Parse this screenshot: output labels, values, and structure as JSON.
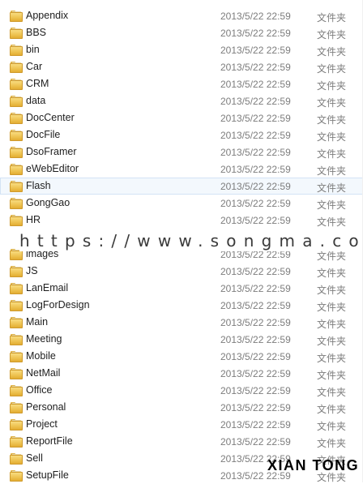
{
  "files": [
    {
      "name": "Appendix",
      "date": "2013/5/22 22:59",
      "type": "文件夹"
    },
    {
      "name": "BBS",
      "date": "2013/5/22 22:59",
      "type": "文件夹"
    },
    {
      "name": "bin",
      "date": "2013/5/22 22:59",
      "type": "文件夹"
    },
    {
      "name": "Car",
      "date": "2013/5/22 22:59",
      "type": "文件夹"
    },
    {
      "name": "CRM",
      "date": "2013/5/22 22:59",
      "type": "文件夹"
    },
    {
      "name": "data",
      "date": "2013/5/22 22:59",
      "type": "文件夹"
    },
    {
      "name": "DocCenter",
      "date": "2013/5/22 22:59",
      "type": "文件夹"
    },
    {
      "name": "DocFile",
      "date": "2013/5/22 22:59",
      "type": "文件夹"
    },
    {
      "name": "DsoFramer",
      "date": "2013/5/22 22:59",
      "type": "文件夹"
    },
    {
      "name": "eWebEditor",
      "date": "2013/5/22 22:59",
      "type": "文件夹"
    },
    {
      "name": "Flash",
      "date": "2013/5/22 22:59",
      "type": "文件夹",
      "selected": true
    },
    {
      "name": "GongGao",
      "date": "2013/5/22 22:59",
      "type": "文件夹"
    },
    {
      "name": "HR",
      "date": "2013/5/22 22:59",
      "type": "文件夹"
    },
    {
      "name": "",
      "date": "",
      "type": "",
      "hidden": true
    },
    {
      "name": "images",
      "date": "2013/5/22 22:59",
      "type": "文件夹"
    },
    {
      "name": "JS",
      "date": "2013/5/22 22:59",
      "type": "文件夹"
    },
    {
      "name": "LanEmail",
      "date": "2013/5/22 22:59",
      "type": "文件夹"
    },
    {
      "name": "LogForDesign",
      "date": "2013/5/22 22:59",
      "type": "文件夹"
    },
    {
      "name": "Main",
      "date": "2013/5/22 22:59",
      "type": "文件夹"
    },
    {
      "name": "Meeting",
      "date": "2013/5/22 22:59",
      "type": "文件夹"
    },
    {
      "name": "Mobile",
      "date": "2013/5/22 22:59",
      "type": "文件夹"
    },
    {
      "name": "NetMail",
      "date": "2013/5/22 22:59",
      "type": "文件夹"
    },
    {
      "name": "Office",
      "date": "2013/5/22 22:59",
      "type": "文件夹"
    },
    {
      "name": "Personal",
      "date": "2013/5/22 22:59",
      "type": "文件夹"
    },
    {
      "name": "Project",
      "date": "2013/5/22 22:59",
      "type": "文件夹"
    },
    {
      "name": "ReportFile",
      "date": "2013/5/22 22:59",
      "type": "文件夹"
    },
    {
      "name": "Sell",
      "date": "2013/5/22 22:59",
      "type": "文件夹"
    },
    {
      "name": "SetupFile",
      "date": "2013/5/22 22:59",
      "type": "文件夹"
    }
  ],
  "icons": {
    "row": "folder-icon"
  },
  "watermark": "https://www.songma.com",
  "corner_mark": "XIAN TONG",
  "colors": {
    "selected_bg": "#f3f8fd",
    "selected_border": "#d3e3f5",
    "folder": "#eec453",
    "meta_text": "#7d7d7d"
  }
}
